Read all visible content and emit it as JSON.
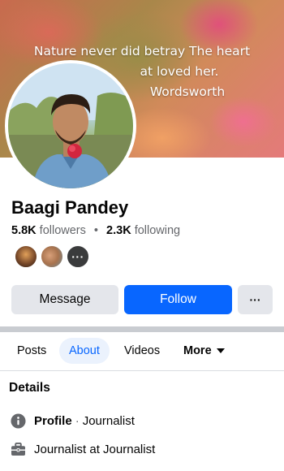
{
  "cover": {
    "quote_line1": "Nature never did betray The heart",
    "quote_line2": "at loved her.",
    "quote_line3": "Wordsworth"
  },
  "profile": {
    "name": "Baagi Pandey",
    "followers_count": "5.8K",
    "followers_label": "followers",
    "following_count": "2.3K",
    "following_label": "following",
    "separator": "•",
    "mutual_more": "···"
  },
  "actions": {
    "message": "Message",
    "follow": "Follow",
    "more": "···"
  },
  "tabs": [
    {
      "label": "Posts",
      "active": false
    },
    {
      "label": "About",
      "active": true
    },
    {
      "label": "Videos",
      "active": false
    },
    {
      "label": "More",
      "active": false
    }
  ],
  "details": {
    "title": "Details",
    "items": [
      {
        "icon": "info-icon",
        "strong": "Profile",
        "sep": "·",
        "text": "Journalist"
      },
      {
        "icon": "briefcase-icon",
        "strong": "",
        "sep": "",
        "text": "Journalist at Journalist"
      }
    ]
  },
  "colors": {
    "follow_blue": "#0866ff",
    "button_gray": "#e4e6eb",
    "tab_active_bg": "#ebf2fd"
  }
}
